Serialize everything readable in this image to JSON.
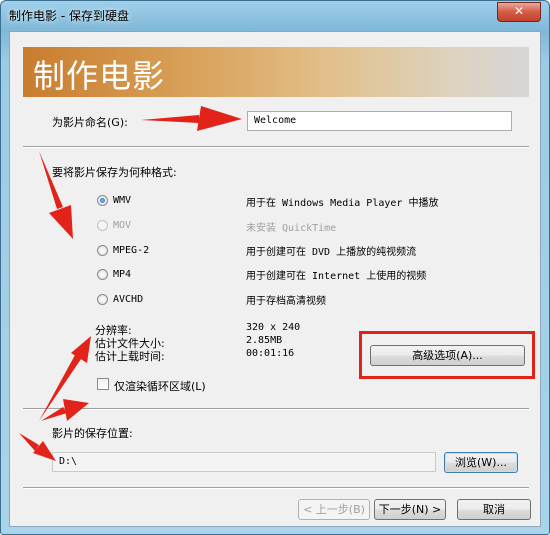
{
  "window": {
    "title": "制作电影 - 保存到硬盘",
    "close_glyph": "✕"
  },
  "banner": {
    "title": "制作电影"
  },
  "name_section": {
    "label": "为影片命名(G):",
    "value": "Welcome"
  },
  "format_section": {
    "label": "要将影片保存为何种格式:",
    "options": [
      {
        "name": "WMV",
        "description": "用于在 Windows Media Player 中播放",
        "selected": true,
        "enabled": true
      },
      {
        "name": "MOV",
        "description": "未安装 QuickTime",
        "selected": false,
        "enabled": false
      },
      {
        "name": "MPEG-2",
        "description": "用于创建可在 DVD 上播放的纯视频流",
        "selected": false,
        "enabled": true
      },
      {
        "name": "MP4",
        "description": "用于创建可在 Internet 上使用的视频",
        "selected": false,
        "enabled": true
      },
      {
        "name": "AVCHD",
        "description": "用于存档高清视频",
        "selected": false,
        "enabled": true
      }
    ]
  },
  "info": {
    "resolution_label": "分辨率:",
    "resolution_value": "320 x 240",
    "filesize_label": "估计文件大小:",
    "filesize_value": "2.85MB",
    "upload_label": "估计上载时间:",
    "upload_value": "00:01:16"
  },
  "advanced_button": "高级选项(A)...",
  "loop_checkbox": {
    "label": "仅渲染循环区域(L)",
    "checked": false
  },
  "location_section": {
    "label": "影片的保存位置:",
    "value": "D:\\",
    "browse_button": "浏览(W)..."
  },
  "footer": {
    "back_button": "< 上一步(B)",
    "next_button": "下一步(N) >",
    "cancel_button": "取消"
  },
  "annotation_color": "#e2231a"
}
